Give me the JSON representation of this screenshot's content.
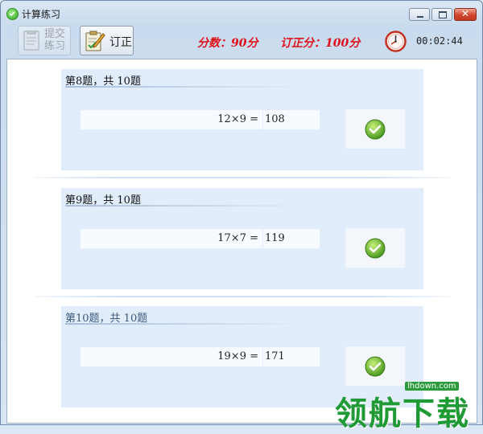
{
  "window": {
    "title": "计算练习"
  },
  "toolbar": {
    "submit_label": "提交练习",
    "correct_label": "订正",
    "score_text": "分数：90分",
    "corrected_score_text": "订正分：100分",
    "timer": "00:02:44"
  },
  "questions": [
    {
      "header": "第8题，共 10题",
      "equation": "12×9 =",
      "answer": "108",
      "result": "correct"
    },
    {
      "header": "第9题，共 10题",
      "equation": "17×7 =",
      "answer": "119",
      "result": "correct"
    },
    {
      "header": "第10题，共 10题",
      "equation": "19×9 =",
      "answer": "171",
      "result": "correct"
    }
  ],
  "watermark": {
    "url": "lhdown.com",
    "text": "领航下载"
  },
  "colors": {
    "score_red": "#e0101a",
    "check_green": "#5fb42a",
    "card_bg": "#e1edfb"
  }
}
